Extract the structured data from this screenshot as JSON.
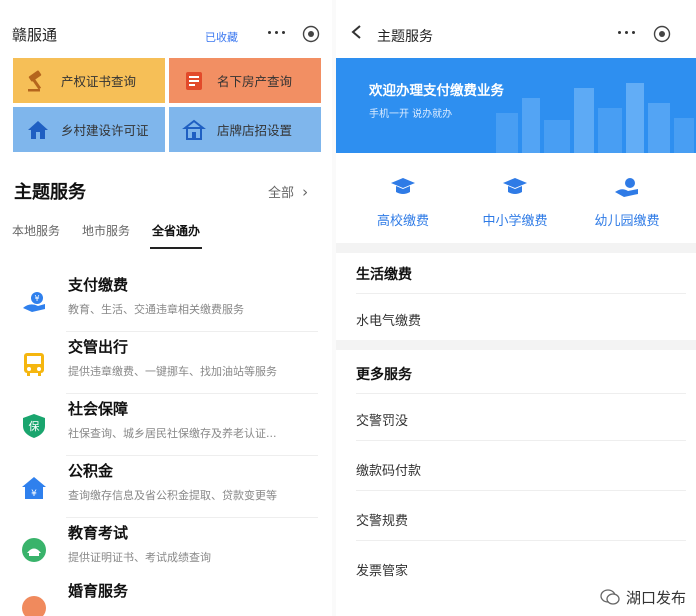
{
  "left": {
    "title": "赣服通",
    "fav_label": "已收藏",
    "tiles": [
      {
        "label": "产权证书查询",
        "icon": "gavel-icon"
      },
      {
        "label": "名下房产查询",
        "icon": "property-icon"
      },
      {
        "label": "乡村建设许可证",
        "icon": "house-icon"
      },
      {
        "label": "店牌店招设置",
        "icon": "shop-icon"
      }
    ],
    "section_title": "主题服务",
    "all_label": "全部",
    "tabs": [
      "本地服务",
      "地市服务",
      "全省通办"
    ],
    "active_tab": "全省通办",
    "services": [
      {
        "name": "支付缴费",
        "desc": "教育、生活、交通违章相关缴费服务",
        "icon": "payment-icon",
        "color": "#2f80ed"
      },
      {
        "name": "交管出行",
        "desc": "提供违章缴费、一键挪车、找加油站等服务",
        "icon": "bus-icon",
        "color": "#f5b60f"
      },
      {
        "name": "社会保障",
        "desc": "社保查询、城乡居民社保缴存及养老认证...",
        "icon": "shield-icon",
        "color": "#1aa56e"
      },
      {
        "name": "公积金",
        "desc": "查询缴存信息及省公积金提取、贷款变更等",
        "icon": "house-fund-icon",
        "color": "#2f80ed"
      },
      {
        "name": "教育考试",
        "desc": "提供证明证书、考试成绩查询",
        "icon": "education-icon",
        "color": "#39b36b"
      },
      {
        "name": "婚育服务",
        "desc": "",
        "icon": "family-icon",
        "color": "#f08a5d"
      }
    ]
  },
  "right": {
    "title": "主题服务",
    "banner_title": "欢迎办理支付缴费业务",
    "banner_sub": "手机一开 说办就办",
    "fees": [
      {
        "label": "高校缴费",
        "icon": "graduation-cap-icon"
      },
      {
        "label": "中小学缴费",
        "icon": "graduation-cap-icon"
      },
      {
        "label": "幼儿园缴费",
        "icon": "hand-coin-icon"
      }
    ],
    "life_title": "生活缴费",
    "life_items": [
      "水电气缴费"
    ],
    "more_title": "更多服务",
    "more_items": [
      "交警罚没",
      "缴款码付款",
      "交警规费",
      "发票管家"
    ]
  },
  "watermark": "湖口发布",
  "colors": {
    "accent": "#2f80ed",
    "banner": "#2e8ff0",
    "tile_yellow": "#f6bf57",
    "tile_orange": "#f28f63",
    "tile_blue": "#7fb6ec"
  }
}
